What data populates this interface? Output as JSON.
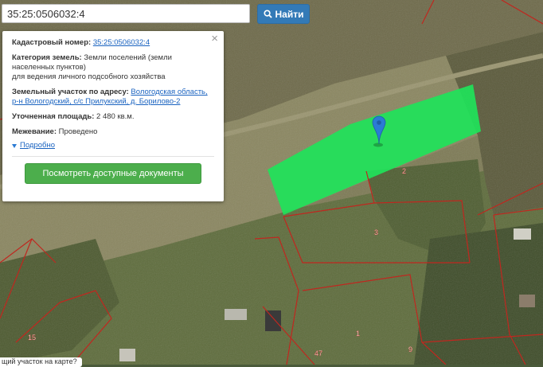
{
  "search": {
    "value": "35:25:0506032:4",
    "button_label": "Найти"
  },
  "panel": {
    "close_glyph": "×",
    "cadastral_label": "Кадастровый номер:",
    "cadastral_value": "35:25:0506032:4",
    "category_label": "Категория земель:",
    "category_value": "Земли поселений (земли населенных пунктов)",
    "usage_value": "для ведения личного подсобного хозяйства",
    "address_label": "Земельный участок по адресу:",
    "address_value": "Вологодская область, р-н Вологодский, с/с Прилукский, д. Борилово-2",
    "area_label": "Уточненная площадь:",
    "area_value": "2 480 кв.м.",
    "survey_label": "Межевание:",
    "survey_value": "Проведено",
    "more_label": "Подробно",
    "docs_button": "Посмотреть доступные документы"
  },
  "map": {
    "plot_labels": [
      "2",
      "3",
      "1",
      "47",
      "9",
      "15"
    ],
    "parcel_color": "#1fe35a",
    "boundary_color": "#c0271f",
    "marker_color": "#2b7bd4"
  },
  "bottom_tip": "щий участок на карте?"
}
